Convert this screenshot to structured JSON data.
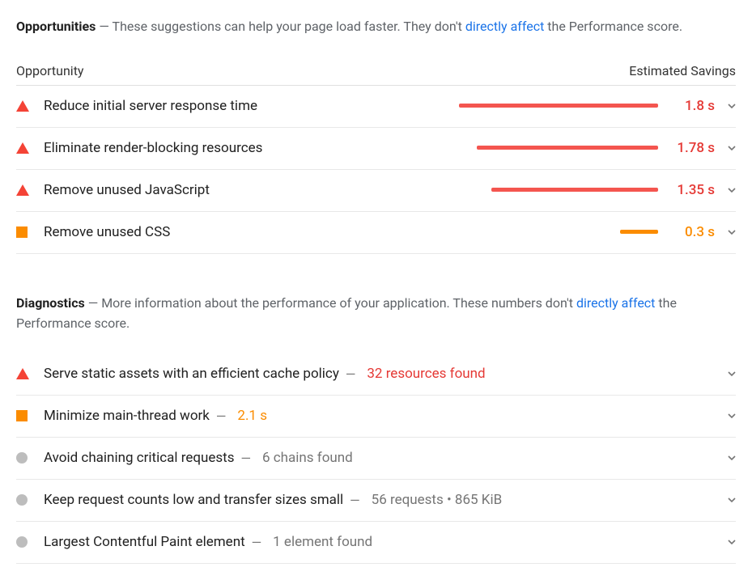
{
  "opportunities": {
    "title": "Opportunities",
    "desc_prefix": " — These suggestions can help your page load faster. They don't ",
    "desc_link": "directly affect",
    "desc_suffix": " the Performance score.",
    "col_opportunity": "Opportunity",
    "col_savings": "Estimated Savings",
    "items": [
      {
        "icon": "triangle-red",
        "label": "Reduce initial server response time",
        "bar_pct": 51,
        "bar_color": "red",
        "savings": "1.8 s",
        "savings_color": "red"
      },
      {
        "icon": "triangle-red",
        "label": "Eliminate render-blocking resources",
        "bar_pct": 47,
        "bar_color": "red",
        "savings": "1.78 s",
        "savings_color": "red"
      },
      {
        "icon": "triangle-red",
        "label": "Remove unused JavaScript",
        "bar_pct": 38,
        "bar_color": "red",
        "savings": "1.35 s",
        "savings_color": "red"
      },
      {
        "icon": "square-orange",
        "label": "Remove unused CSS",
        "bar_pct": 8,
        "bar_color": "orange",
        "savings": "0.3 s",
        "savings_color": "orange"
      }
    ]
  },
  "diagnostics": {
    "title": "Diagnostics",
    "desc_prefix": " — More information about the performance of your application. These numbers don't ",
    "desc_link": "directly affect",
    "desc_suffix": " the Performance score.",
    "items": [
      {
        "icon": "triangle-red",
        "label": "Serve static assets with an efficient cache policy",
        "detail": "32 resources found",
        "detail_color": "red"
      },
      {
        "icon": "square-orange",
        "label": "Minimize main-thread work",
        "detail": "2.1 s",
        "detail_color": "orange"
      },
      {
        "icon": "circle-gray",
        "label": "Avoid chaining critical requests",
        "detail": "6 chains found",
        "detail_color": "gray"
      },
      {
        "icon": "circle-gray",
        "label": "Keep request counts low and transfer sizes small",
        "detail": "56 requests • 865 KiB",
        "detail_color": "gray"
      },
      {
        "icon": "circle-gray",
        "label": "Largest Contentful Paint element",
        "detail": "1 element found",
        "detail_color": "gray"
      }
    ]
  },
  "chart_data": {
    "type": "bar",
    "title": "Opportunities — Estimated Savings",
    "xlabel": "Opportunity",
    "ylabel": "Estimated Savings (s)",
    "categories": [
      "Reduce initial server response time",
      "Eliminate render-blocking resources",
      "Remove unused JavaScript",
      "Remove unused CSS"
    ],
    "values": [
      1.8,
      1.78,
      1.35,
      0.3
    ],
    "ylim": [
      0,
      2.0
    ]
  }
}
